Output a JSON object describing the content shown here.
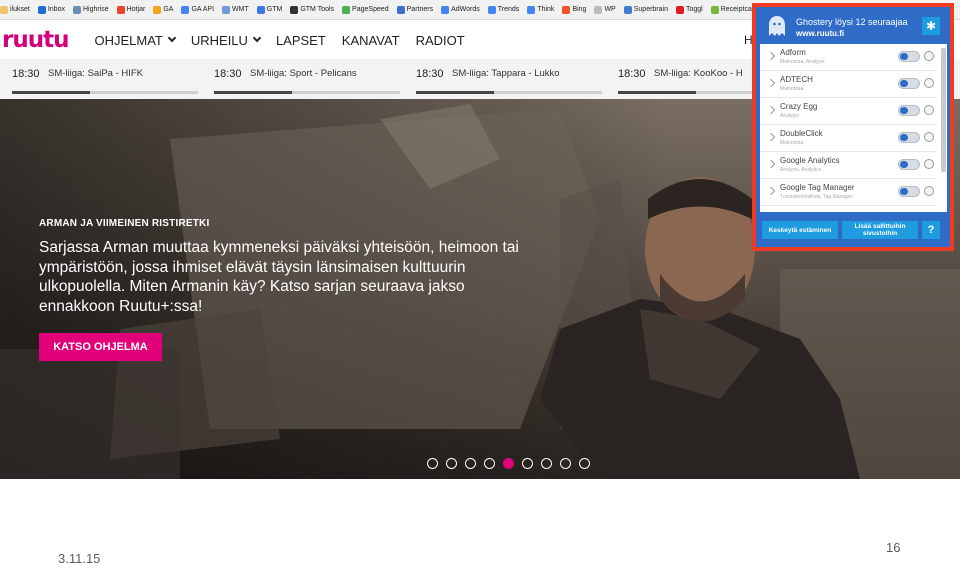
{
  "bookmarks": [
    {
      "label": "ilukset",
      "icon": "folder-icon",
      "color": "#f0c36d"
    },
    {
      "label": "Inbox",
      "icon": "mail-icon",
      "color": "#1e6fd9"
    },
    {
      "label": "Highrise",
      "icon": "highrise-icon",
      "color": "#6a8fb5"
    },
    {
      "label": "Hotjar",
      "icon": "hotjar-icon",
      "color": "#e9452b"
    },
    {
      "label": "GA",
      "icon": "analytics-icon",
      "color": "#f4a21a"
    },
    {
      "label": "GA API",
      "icon": "google-icon",
      "color": "#4285f4"
    },
    {
      "label": "WMT",
      "icon": "webmaster-icon",
      "color": "#6c9ad6"
    },
    {
      "label": "GTM",
      "icon": "tag-icon",
      "color": "#3b78e7"
    },
    {
      "label": "GTM Tools",
      "icon": "github-icon",
      "color": "#333333"
    },
    {
      "label": "PageSpeed",
      "icon": "pagespeed-icon",
      "color": "#4caf50"
    },
    {
      "label": "Partners",
      "icon": "partners-icon",
      "color": "#3c6fc9"
    },
    {
      "label": "AdWords",
      "icon": "google-icon",
      "color": "#4285f4"
    },
    {
      "label": "Trends",
      "icon": "google-icon",
      "color": "#4285f4"
    },
    {
      "label": "Think",
      "icon": "google-icon",
      "color": "#4285f4"
    },
    {
      "label": "Bing",
      "icon": "windows-icon",
      "color": "#f35325"
    },
    {
      "label": "WP",
      "icon": "page-icon",
      "color": "#bbbbbb"
    },
    {
      "label": "Superbrain",
      "icon": "superbrain-icon",
      "color": "#3f7ed1"
    },
    {
      "label": "Toggl",
      "icon": "toggl-icon",
      "color": "#e01b22"
    },
    {
      "label": "Receiptcam",
      "icon": "receipt-icon",
      "color": "#78b83e"
    }
  ],
  "header": {
    "logo": "ruutu",
    "nav": [
      "OHJELMAT",
      "URHEILU",
      "LAPSET",
      "KANAVAT",
      "RADIOT"
    ],
    "nav_has_dropdown": [
      true,
      true,
      false,
      false,
      false
    ],
    "cut_text": "H"
  },
  "schedule": [
    {
      "time": "18:30",
      "title": "SM-liiga: SaiPa - HIFK",
      "progress": 0.42
    },
    {
      "time": "18:30",
      "title": "SM-liiga: Sport - Pelicans",
      "progress": 0.42
    },
    {
      "time": "18:30",
      "title": "SM-liiga: Tappara - Lukko",
      "progress": 0.42
    },
    {
      "time": "18:30",
      "title": "SM-liiga: KooKoo - H",
      "progress": 0.42
    }
  ],
  "hero": {
    "kicker": "ARMAN JA VIIMEINEN RISTIRETKI",
    "description": "Sarjassa Arman muuttaa kymmeneksi päiväksi yhteisöön, heimoon tai ympäristöön, jossa ihmiset elävät täysin länsimaisen kulttuurin ulkopuolella. Miten Armanin käy? Katso sarjan seuraava jakso ennakkoon Ruutu+:ssa!",
    "cta": "KATSO OHJELMA",
    "slides_total": 9,
    "active_slide": 4
  },
  "ghostery": {
    "title": "Ghostery löysi 12 seuraajaa",
    "site": "www.ruutu.fi",
    "trackers": [
      {
        "name": "Adform",
        "category": "Mainontaa, Analyysi"
      },
      {
        "name": "ADTECH",
        "category": "Mainontaa"
      },
      {
        "name": "Crazy Egg",
        "category": "Analyysi"
      },
      {
        "name": "DoubleClick",
        "category": "Mainontaa"
      },
      {
        "name": "Google Analytics",
        "category": "Analyysi, Analytics"
      },
      {
        "name": "Google Tag Manager",
        "category": "Tunnisteenhallinta, Tag Manager"
      }
    ],
    "pause_button": "Keskeytä estäminen",
    "whitelist_button": "Lisää sallittuihin sivustoihin",
    "help_button": "?",
    "accent": "#2f6cc7",
    "highlight_border": "#ef3b24"
  },
  "slide": {
    "date": "3.11.15",
    "number": "16"
  }
}
